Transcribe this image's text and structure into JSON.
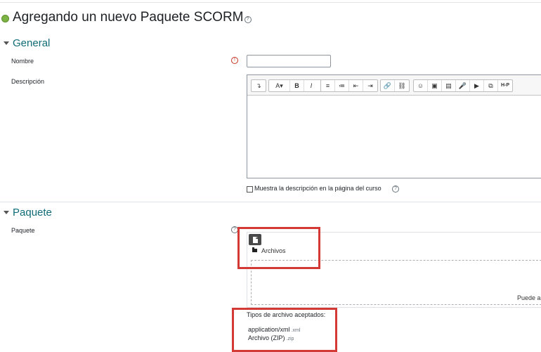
{
  "page": {
    "title": "Agregando un nuevo Paquete SCORM"
  },
  "general": {
    "heading": "General",
    "name_label": "Nombre",
    "description_label": "Descripción",
    "show_description_label": "Muestra la descripción en la página del curso"
  },
  "toolbar": {
    "buttons": [
      "↴",
      "A▾",
      "B",
      "I",
      "≡",
      "≔",
      "⇤",
      "⇥",
      "🔗",
      "⛓",
      "☺",
      "▣",
      "▤",
      "🎤",
      "▶",
      "⧉",
      "H-P"
    ]
  },
  "package": {
    "heading": "Paquete",
    "label": "Paquete",
    "files_folder": "Archivos",
    "drop_hint": "Puede a",
    "accepted_types_title": "Tipos de archivo aceptados:",
    "types": [
      {
        "name": "application/xml",
        "ext": ".xml"
      },
      {
        "name": "Archivo (ZIP)",
        "ext": ".zip"
      }
    ]
  },
  "colors": {
    "heading": "#0f6b76",
    "highlight": "#d43a35",
    "required": "#ca3120"
  }
}
